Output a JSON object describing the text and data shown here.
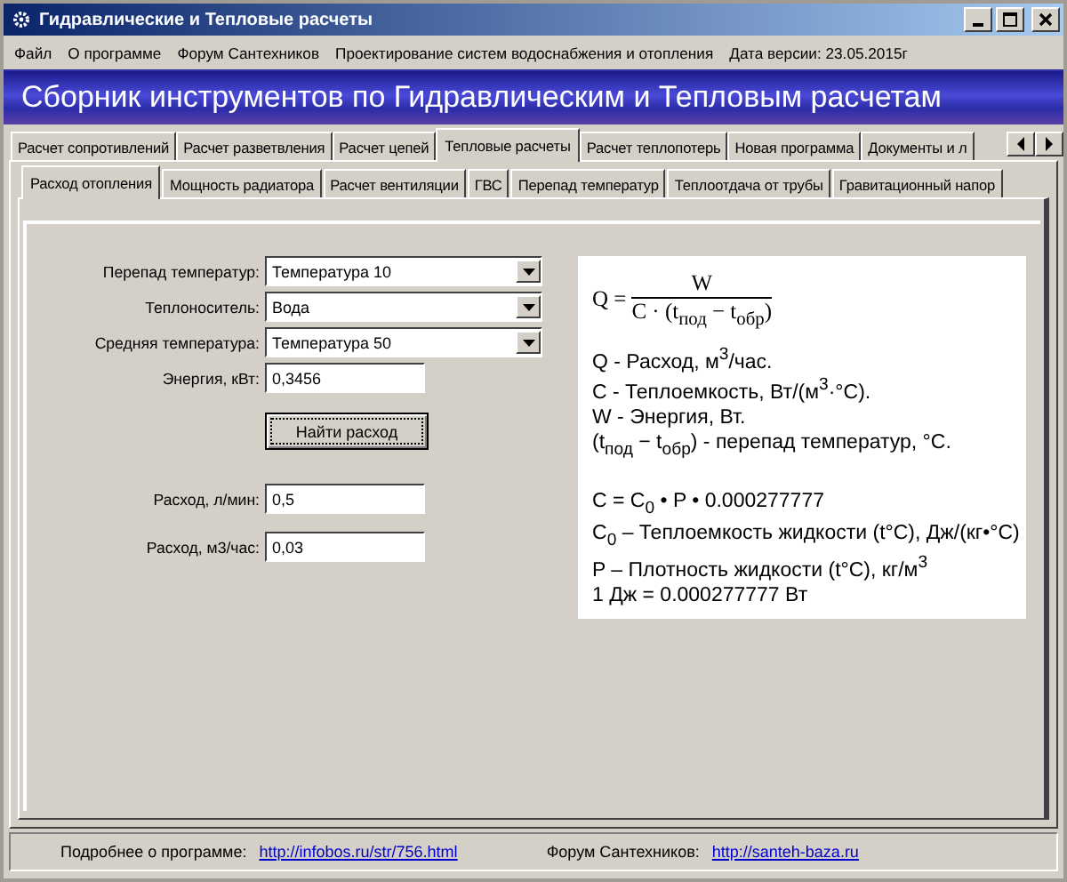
{
  "window": {
    "title": "Гидравлические и Тепловые расчеты"
  },
  "menu": [
    "Файл",
    "О программе",
    "Форум Сантехников",
    "Проектирование систем водоснабжения и отопления",
    "Дата версии: 23.05.2015г"
  ],
  "banner": {
    "title": "Сборник инструментов по Гидравлическим и Тепловым расчетам"
  },
  "tabs": [
    {
      "label": "Расчет сопротивлений",
      "selected": false
    },
    {
      "label": "Расчет разветвления",
      "selected": false
    },
    {
      "label": "Расчет цепей",
      "selected": false
    },
    {
      "label": "Тепловые расчеты",
      "selected": true
    },
    {
      "label": "Расчет теплопотерь",
      "selected": false
    },
    {
      "label": "Новая программа",
      "selected": false
    },
    {
      "label": "Документы и л",
      "selected": false
    }
  ],
  "subtabs": [
    {
      "label": "Расход отопления",
      "selected": true
    },
    {
      "label": "Мощность радиатора",
      "selected": false
    },
    {
      "label": "Расчет вентиляции",
      "selected": false
    },
    {
      "label": "ГВС",
      "selected": false
    },
    {
      "label": "Перепад температур",
      "selected": false
    },
    {
      "label": "Теплоотдача от трубы",
      "selected": false
    },
    {
      "label": "Гравитационный напор",
      "selected": false
    }
  ],
  "form": {
    "fields": [
      {
        "kind": "select",
        "label": "Перепад температур:",
        "value": "Температура 10"
      },
      {
        "kind": "select",
        "label": "Теплоноситель:",
        "value": "Вода"
      },
      {
        "kind": "select",
        "label": "Средняя температура:",
        "value": "Температура 50"
      },
      {
        "kind": "input",
        "label": "Энергия, кВт:",
        "value": "0,3456"
      }
    ],
    "button": "Найти расход",
    "results": [
      {
        "label": "Расход, л/мин:",
        "value": "0,5"
      },
      {
        "label": "Расход, м3/час:",
        "value": "0,03"
      }
    ]
  },
  "formula": {
    "lhs": "Q =",
    "numerator": "W",
    "denominator": "C · (t$_{под}$ − t$_{обр}$)",
    "definitions": [
      "Q - Расход, м$^{3}$/час.",
      "C - Теплоемкость, Вт/(м$^{3}$·°C).",
      "W - Энергия, Вт.",
      "(t$_{под}$ − t$_{обр}$) - перепад температур, °C."
    ],
    "relations": [
      "C = C$_{0}$ • P • 0.000277777",
      "C$_{0}$ – Теплоемкость жидкости (t°C), Дж/(кг•°C)",
      "P – Плотность жидкости (t°C), кг/м$^{3}$",
      "1 Дж = 0.000277777 Вт"
    ]
  },
  "status_bar": [
    {
      "label": "Подробнее о программе:",
      "link": "http://infobos.ru/str/756.html"
    },
    {
      "label": "Форум Сантехников:",
      "link": "http://santeh-baza.ru"
    }
  ]
}
